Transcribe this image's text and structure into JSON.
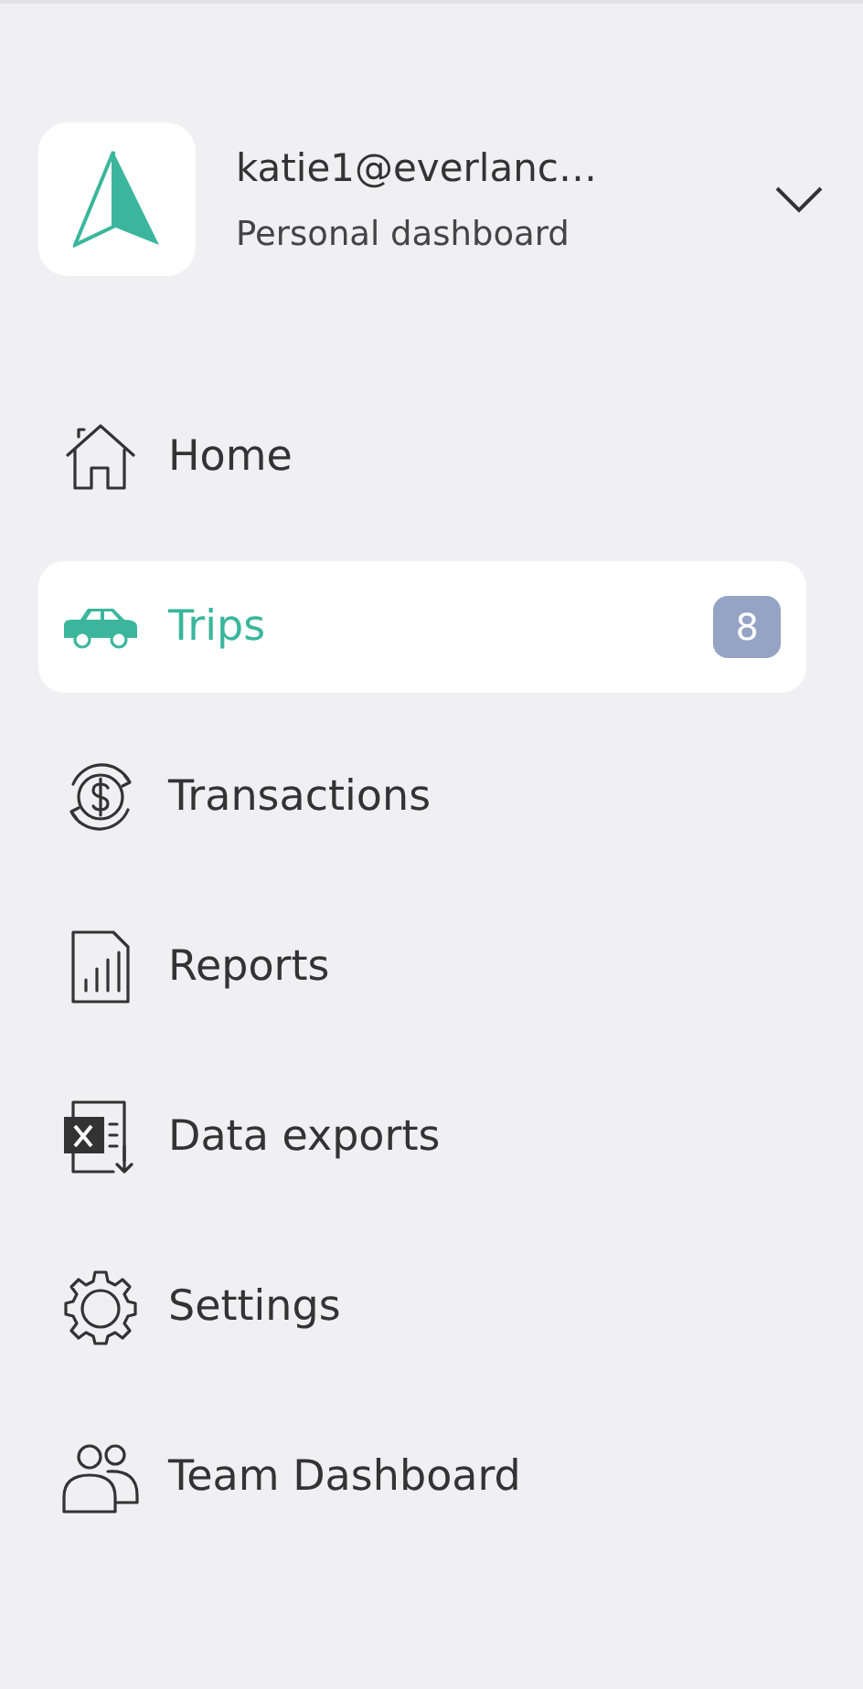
{
  "account": {
    "email": "katie1@everlanc…",
    "subtitle": "Personal dashboard"
  },
  "nav": [
    {
      "kind": "home",
      "label": "Home",
      "selected": false
    },
    {
      "kind": "trips",
      "label": "Trips",
      "selected": true,
      "badge": "8"
    },
    {
      "kind": "transactions",
      "label": "Transactions",
      "selected": false
    },
    {
      "kind": "reports",
      "label": "Reports",
      "selected": false
    },
    {
      "kind": "exports",
      "label": "Data exports",
      "selected": false
    },
    {
      "kind": "settings",
      "label": "Settings",
      "selected": false
    },
    {
      "kind": "team",
      "label": "Team Dashboard",
      "selected": false
    }
  ]
}
